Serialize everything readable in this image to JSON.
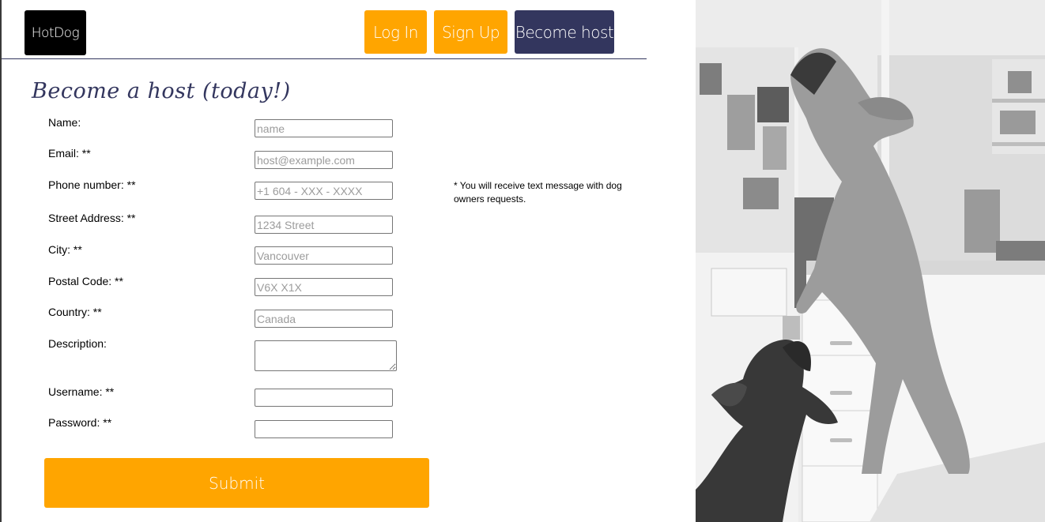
{
  "header": {
    "logo": "HotDog",
    "login_label": "Log In",
    "signup_label": "Sign Up",
    "host_label": "Become host"
  },
  "page": {
    "title": "Become a host (today!)"
  },
  "form": {
    "fields": {
      "name": {
        "label": "Name:",
        "placeholder": "name",
        "value": ""
      },
      "email": {
        "label": "Email: **",
        "placeholder": "host@example.com",
        "value": ""
      },
      "phone": {
        "label": "Phone number: **",
        "placeholder": "+1 604 - XXX - XXXX",
        "value": ""
      },
      "street": {
        "label": "Street Address: **",
        "placeholder": "1234 Street",
        "value": ""
      },
      "city": {
        "label": "City: **",
        "placeholder": "Vancouver",
        "value": ""
      },
      "postal": {
        "label": "Postal Code: **",
        "placeholder": "V6X X1X",
        "value": ""
      },
      "country": {
        "label": "Country: **",
        "placeholder": "Canada",
        "value": ""
      },
      "description": {
        "label": "Description:",
        "placeholder": "",
        "value": ""
      },
      "username": {
        "label": "Username: **",
        "placeholder": "",
        "value": ""
      },
      "password": {
        "label": "Password: **",
        "placeholder": "",
        "value": ""
      }
    },
    "phone_note": "* You will receive text message with dog owners requests.",
    "submit_label": "Submit"
  },
  "theme": {
    "accent_orange": "#ffa500",
    "navy": "#33365e"
  },
  "hero_image": {
    "icon": "dogs-in-kitchen-photo"
  }
}
